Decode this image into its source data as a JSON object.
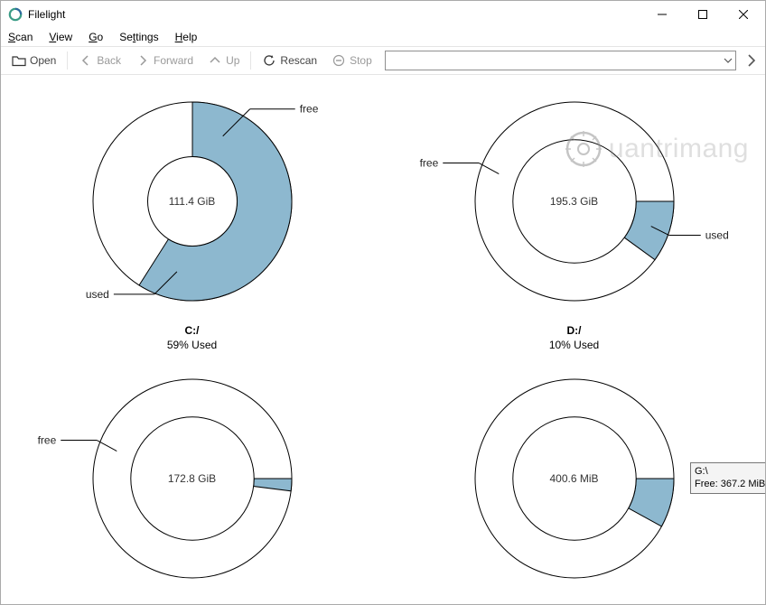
{
  "app": {
    "title": "Filelight"
  },
  "menu": {
    "scan": "Scan",
    "view": "View",
    "go": "Go",
    "settings": "Settings",
    "help": "Help"
  },
  "toolbar": {
    "open": "Open",
    "back": "Back",
    "forward": "Forward",
    "up": "Up",
    "rescan": "Rescan",
    "stop": "Stop"
  },
  "labels": {
    "free": "free",
    "used": "used"
  },
  "colors": {
    "used": "#8db8cf",
    "ring_border": "#000000",
    "free_fill": "#ffffff"
  },
  "drives": [
    {
      "id": "c",
      "name": "C:/",
      "size_text": "111.4 GiB",
      "usage_text": "59% Used",
      "used_pct": 59,
      "used_start_deg": 90,
      "ring_inner_pct": 45,
      "ring_outer_pct": 100,
      "free_label_pos": "top-right",
      "used_label_pos": "bottom-left"
    },
    {
      "id": "d",
      "name": "D:/",
      "size_text": "195.3 GiB",
      "usage_text": "10% Used",
      "used_pct": 10,
      "used_start_deg": 0,
      "ring_inner_pct": 62,
      "ring_outer_pct": 100,
      "free_label_pos": "left",
      "used_label_pos": "right"
    },
    {
      "id": "e",
      "name": "",
      "size_text": "172.8 GiB",
      "usage_text": "",
      "used_pct": 2,
      "used_start_deg": 0,
      "ring_inner_pct": 62,
      "ring_outer_pct": 100,
      "free_label_pos": "left",
      "used_label_pos": ""
    },
    {
      "id": "g",
      "name": "",
      "size_text": "400.6 MiB",
      "usage_text": "",
      "used_pct": 8,
      "used_start_deg": 0,
      "ring_inner_pct": 62,
      "ring_outer_pct": 100,
      "free_label_pos": "",
      "used_label_pos": "",
      "tooltip": "G:\\\nFree: 367.2 MiB"
    }
  ],
  "chart_data": [
    {
      "type": "pie",
      "title": "C:/",
      "subtitle": "111.4 GiB",
      "series": [
        {
          "name": "used",
          "value": 59
        },
        {
          "name": "free",
          "value": 41
        }
      ],
      "caption": "59% Used"
    },
    {
      "type": "pie",
      "title": "D:/",
      "subtitle": "195.3 GiB",
      "series": [
        {
          "name": "used",
          "value": 10
        },
        {
          "name": "free",
          "value": 90
        }
      ],
      "caption": "10% Used"
    },
    {
      "type": "pie",
      "title": "",
      "subtitle": "172.8 GiB",
      "series": [
        {
          "name": "used",
          "value": 2
        },
        {
          "name": "free",
          "value": 98
        }
      ],
      "caption": ""
    },
    {
      "type": "pie",
      "title": "",
      "subtitle": "400.6 MiB",
      "series": [
        {
          "name": "used",
          "value": 8
        },
        {
          "name": "free",
          "value": 92
        }
      ],
      "caption": "",
      "annotation": "G:\\ Free: 367.2 MiB"
    }
  ],
  "watermark": "uantrimang"
}
